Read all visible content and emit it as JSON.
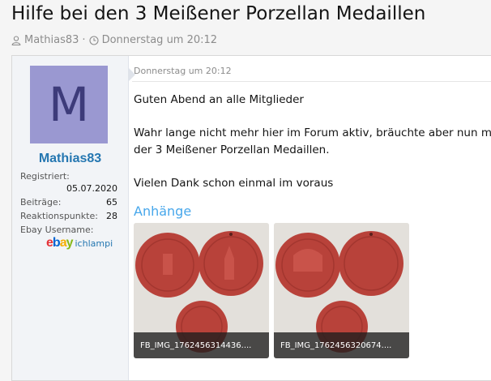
{
  "thread": {
    "title": "Hilfe bei den 3 Meißener Porzellan Medaillen",
    "author": "Mathias83",
    "separator": "·",
    "date": "Donnerstag um 20:12"
  },
  "user": {
    "avatar_letter": "M",
    "name": "Mathias83",
    "stats": [
      {
        "label": "Registriert:",
        "value": "05.07.2020"
      },
      {
        "label": "Beiträge:",
        "value": "65"
      },
      {
        "label": "Reaktionspunkte:",
        "value": "28"
      }
    ],
    "ebay_label": "Ebay Username:",
    "ebay_username": "ichlampi"
  },
  "post": {
    "date": "Donnerstag um 20:12",
    "lines": [
      "Guten Abend an alle Mitglieder",
      "Wahr lange nicht mehr hier im Forum aktiv, bräuchte aber nun mal",
      "der 3 Meißener Porzellan Medaillen.",
      "Vielen Dank schon einmal im voraus"
    ],
    "attachments_title": "Anhänge",
    "attachments": [
      {
        "filename": "FB_IMG_1762456314436...."
      },
      {
        "filename": "FB_IMG_1762456320674...."
      }
    ]
  },
  "colors": {
    "link": "#2577b1",
    "accent": "#47a7eb",
    "avatar_bg": "#9a98d1",
    "medal": "#b8423a"
  },
  "icons": [
    "user-icon",
    "clock-icon",
    "ebay-logo"
  ]
}
